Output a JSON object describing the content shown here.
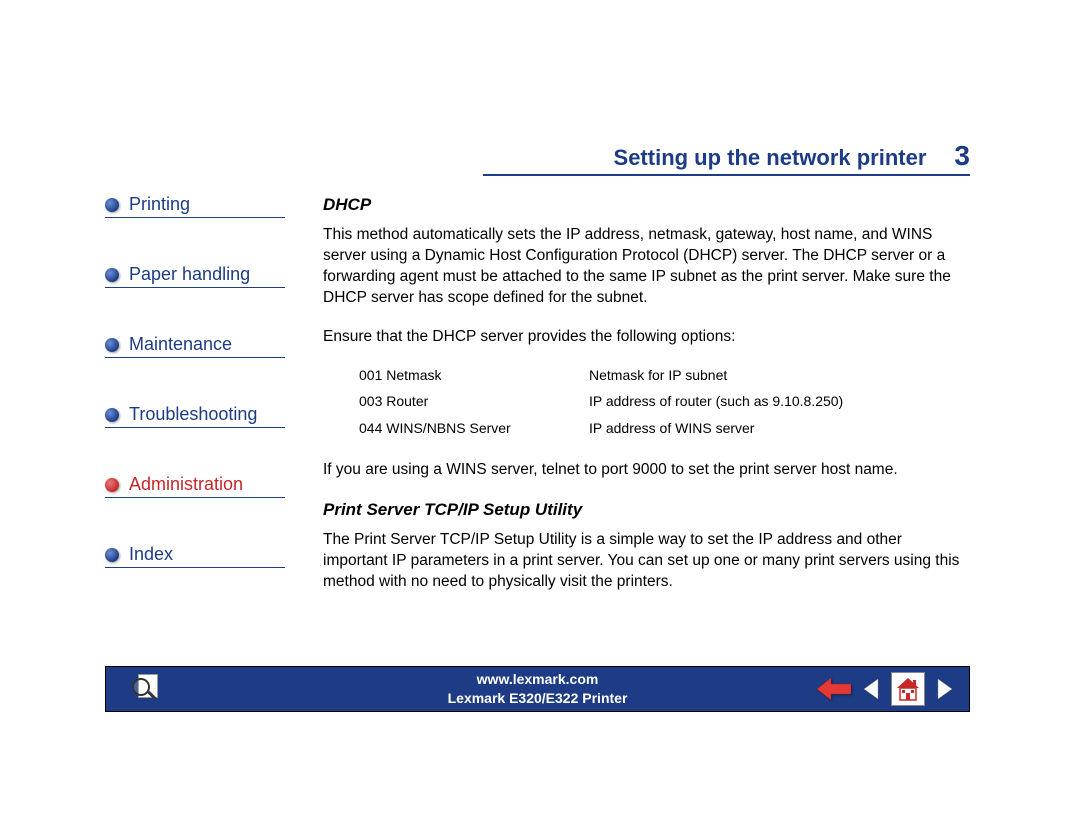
{
  "header": {
    "title": "Setting up the network printer",
    "page_number": "3"
  },
  "sidebar": {
    "items": [
      {
        "label": "Printing",
        "active": false
      },
      {
        "label": "Paper handling",
        "active": false
      },
      {
        "label": "Maintenance",
        "active": false
      },
      {
        "label": "Troubleshooting",
        "active": false
      },
      {
        "label": "Administration",
        "active": true
      },
      {
        "label": "Index",
        "active": false
      }
    ]
  },
  "content": {
    "section1": {
      "heading": "DHCP",
      "para1": "This method automatically sets the IP address, netmask, gateway, host name, and WINS server using a Dynamic Host Configuration Protocol (DHCP) server. The DHCP server or a forwarding agent must be attached to the same IP subnet as the print server. Make sure the DHCP server has scope defined for the subnet.",
      "para2": "Ensure that the DHCP server provides the following options:",
      "options": [
        {
          "code": "001 Netmask",
          "desc": "Netmask for IP subnet"
        },
        {
          "code": "003 Router",
          "desc": "IP address of router (such as 9.10.8.250)"
        },
        {
          "code": "044 WINS/NBNS Server",
          "desc": "IP address of WINS server"
        }
      ],
      "para3": "If you are using a WINS server, telnet to port 9000 to set the print server host name."
    },
    "section2": {
      "heading": "Print Server TCP/IP Setup Utility",
      "para1": "The Print Server TCP/IP Setup Utility is a simple way to set the IP address and other important IP parameters in a print server. You can set up one or many print servers using this method with no need to physically visit the printers."
    }
  },
  "footer": {
    "url": "www.lexmark.com",
    "product": "Lexmark E320/E322 Printer"
  }
}
